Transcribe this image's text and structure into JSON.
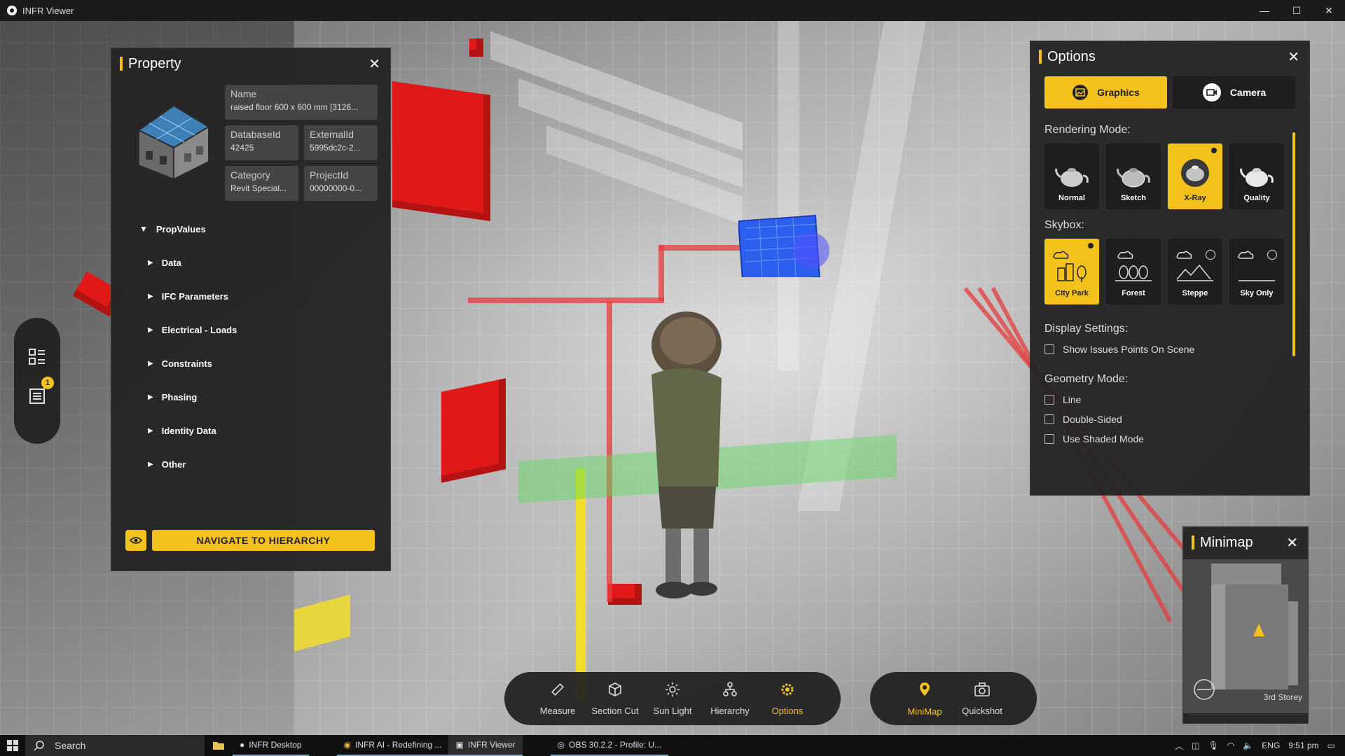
{
  "window": {
    "title": "INFR Viewer",
    "controls": [
      "—",
      "☐",
      "✕"
    ]
  },
  "property": {
    "title": "Property",
    "fields": [
      {
        "label": "Name",
        "value": "raised floor 600 x 600 mm [3126..."
      },
      {
        "label": "DatabaseId",
        "value": "42425"
      },
      {
        "label": "ExternalId",
        "value": "5995dc2c-2..."
      },
      {
        "label": "Category",
        "value": "Revit Special..."
      },
      {
        "label": "ProjectId",
        "value": "00000000-0..."
      }
    ],
    "root_label": "PropValues",
    "groups": [
      "Data",
      "IFC Parameters",
      "Electrical - Loads",
      "Constraints",
      "Phasing",
      "Identity Data",
      "Other"
    ],
    "navigate_label": "NAVIGATE TO HIERARCHY"
  },
  "left_tools": {
    "badge_count": "1"
  },
  "options": {
    "title": "Options",
    "tabs": [
      "Graphics",
      "Camera"
    ],
    "rendering_title": "Rendering Mode:",
    "rendering_modes": [
      "Normal",
      "Sketch",
      "X-Ray",
      "Quality"
    ],
    "rendering_selected": "X-Ray",
    "skybox_title": "Skybox:",
    "skyboxes": [
      "City Park",
      "Forest",
      "Steppe",
      "Sky Only"
    ],
    "skybox_selected": "City Park",
    "display_title": "Display Settings:",
    "display_options": [
      "Show Issues Points On Scene"
    ],
    "geometry_title": "Geometry Mode:",
    "geometry_options": [
      "Line",
      "Double-Sided",
      "Use Shaded Mode"
    ]
  },
  "minimap": {
    "title": "Minimap",
    "storey": "3rd Storey"
  },
  "toolbar": {
    "main": [
      "Measure",
      "Section Cut",
      "Sun Light",
      "Hierarchy",
      "Options"
    ],
    "active": "Options",
    "secondary": [
      "MiniMap",
      "Quickshot"
    ]
  },
  "taskbar": {
    "search_placeholder": "Search",
    "tasks": [
      "INFR Desktop",
      "INFR AI - Redefining ...",
      "INFR Viewer",
      "OBS 30.2.2 - Profile: U..."
    ],
    "tray_lang": "ENG",
    "time": "9:51 pm"
  },
  "colors": {
    "accent": "#f4c21a",
    "panel": "#242424",
    "scene_red": "#e01818",
    "scene_blue": "#2b5ff0"
  }
}
